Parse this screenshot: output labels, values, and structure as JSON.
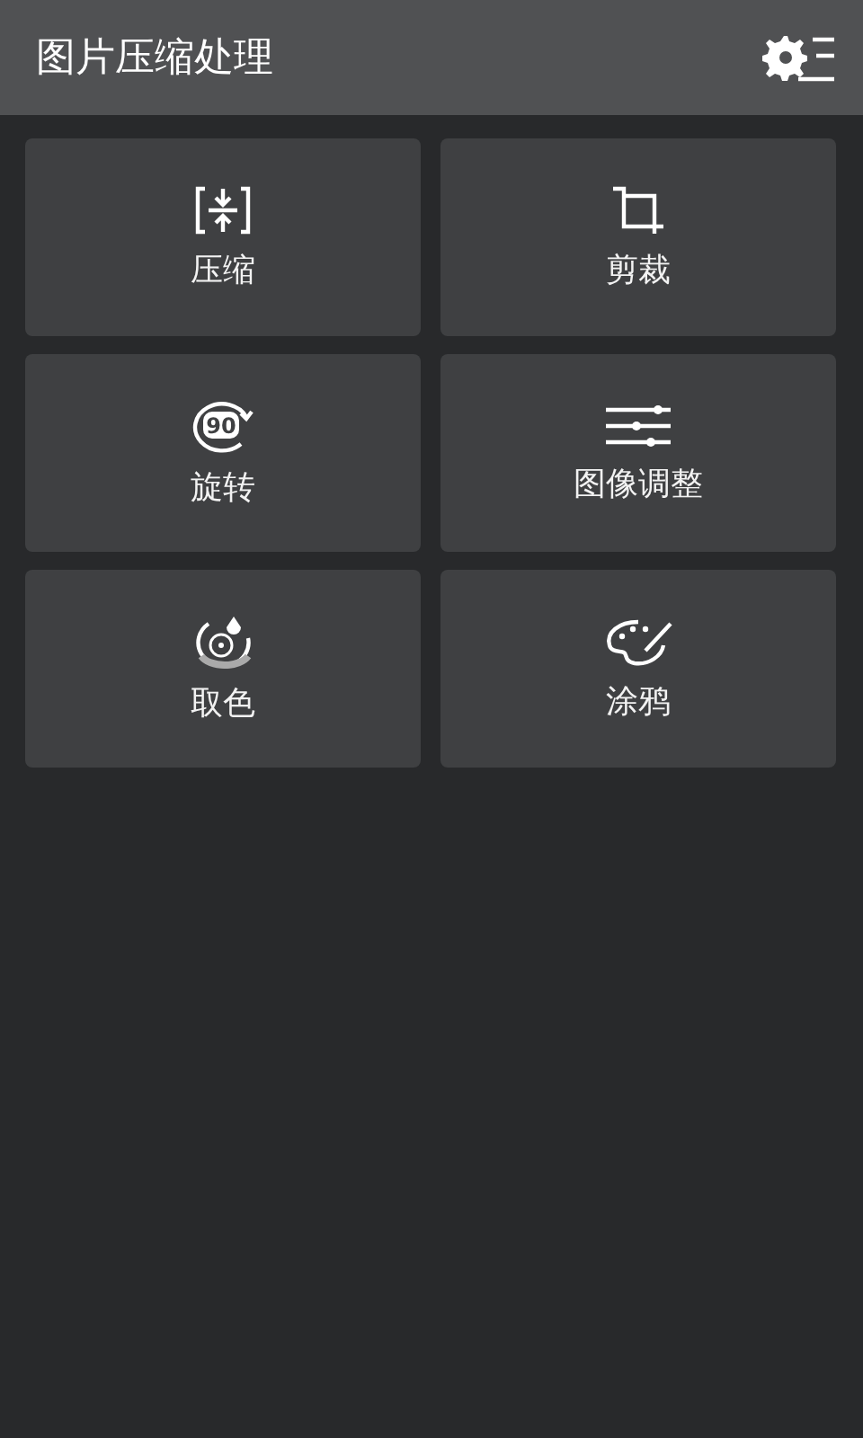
{
  "header": {
    "title": "图片压缩处理"
  },
  "tools": [
    {
      "kind": "compress",
      "label": "压缩"
    },
    {
      "kind": "crop",
      "label": "剪裁"
    },
    {
      "kind": "rotate",
      "label": "旋转",
      "icon_text": "90"
    },
    {
      "kind": "adjust",
      "label": "图像调整"
    },
    {
      "kind": "picker",
      "label": "取色"
    },
    {
      "kind": "paint",
      "label": "涂鸦"
    }
  ]
}
